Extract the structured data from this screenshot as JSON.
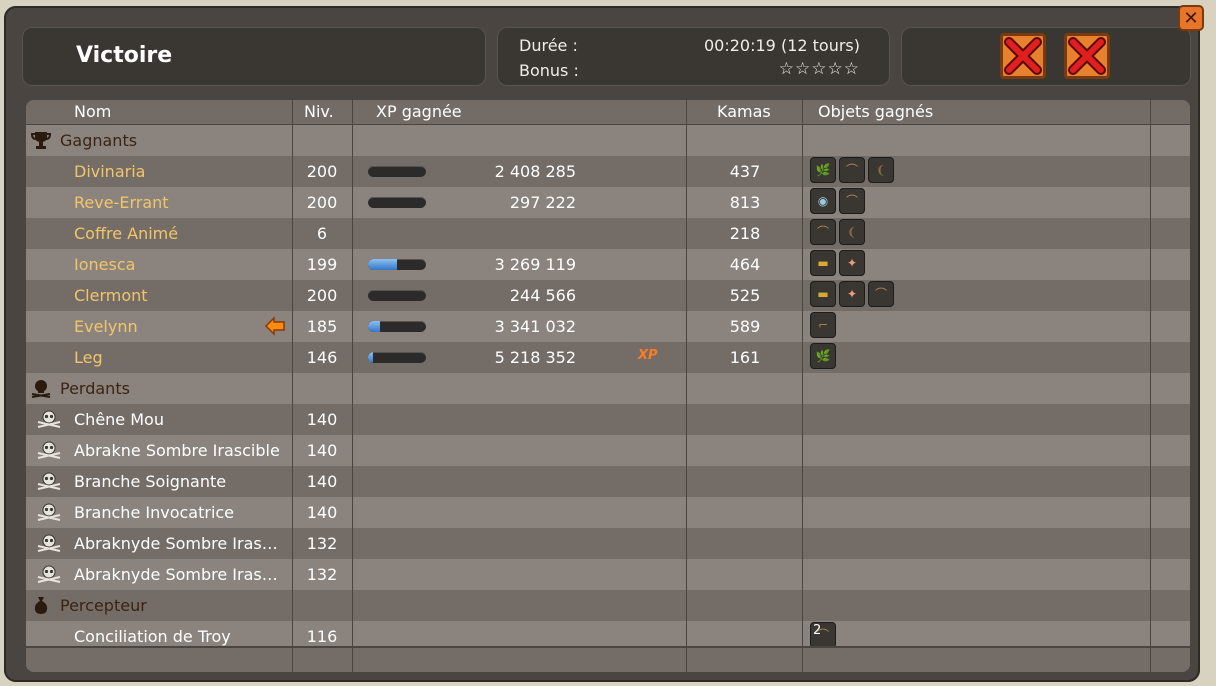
{
  "header": {
    "title": "Victoire",
    "duration_label": "Durée :",
    "duration_value": "00:20:19 (12 tours)",
    "bonus_label": "Bonus :",
    "bonus_stars": "☆☆☆☆☆"
  },
  "columns": {
    "name": "Nom",
    "level": "Niv.",
    "xp": "XP gagnée",
    "kamas": "Kamas",
    "items": "Objets gagnés"
  },
  "sections": {
    "winners": "Gagnants",
    "losers": "Perdants",
    "collector": "Percepteur"
  },
  "winners": [
    {
      "name": "Divinaria",
      "level": "200",
      "xp": "2 408 285",
      "xp_fill": 0,
      "kamas": "437",
      "items": [
        "leaf",
        "branch",
        "bark"
      ]
    },
    {
      "name": "Reve-Errant",
      "level": "200",
      "xp": "297 222",
      "xp_fill": 0,
      "kamas": "813",
      "items": [
        "orb",
        "branch"
      ]
    },
    {
      "name": "Coffre Animé",
      "level": "6",
      "xp": "",
      "xp_fill": null,
      "kamas": "218",
      "items": [
        "branch",
        "bark"
      ]
    },
    {
      "name": "Ionesca",
      "level": "199",
      "xp": "3 269 119",
      "xp_fill": 0.5,
      "kamas": "464",
      "items": [
        "log",
        "candy"
      ]
    },
    {
      "name": "Clermont",
      "level": "200",
      "xp": "244 566",
      "xp_fill": 0,
      "kamas": "525",
      "items": [
        "log",
        "candy",
        "branch"
      ]
    },
    {
      "name": "Evelynn",
      "level": "185",
      "xp": "3 341 032",
      "xp_fill": 0.2,
      "kamas": "589",
      "items": [
        "twig"
      ]
    },
    {
      "name": "Leg",
      "level": "146",
      "xp": "5 218 352",
      "xp_fill": 0.08,
      "kamas": "161",
      "items": [
        "leaf"
      ]
    }
  ],
  "xp_badge": "XP",
  "losers": [
    {
      "name": "Chêne Mou",
      "level": "140"
    },
    {
      "name": "Abrakne Sombre Irascible",
      "level": "140"
    },
    {
      "name": "Branche Soignante",
      "level": "140"
    },
    {
      "name": "Branche Invocatrice",
      "level": "140"
    },
    {
      "name": "Abraknyde Sombre Iras…",
      "level": "132"
    },
    {
      "name": "Abraknyde Sombre Iras…",
      "level": "132"
    }
  ],
  "collector": [
    {
      "name": "Conciliation de Troy",
      "level": "116",
      "item_count": "2"
    }
  ],
  "colors": {
    "winner_name": "#f2c56a",
    "accent_orange": "#e8812e",
    "row_dark": "#746d67",
    "row_light": "#8b847e"
  }
}
